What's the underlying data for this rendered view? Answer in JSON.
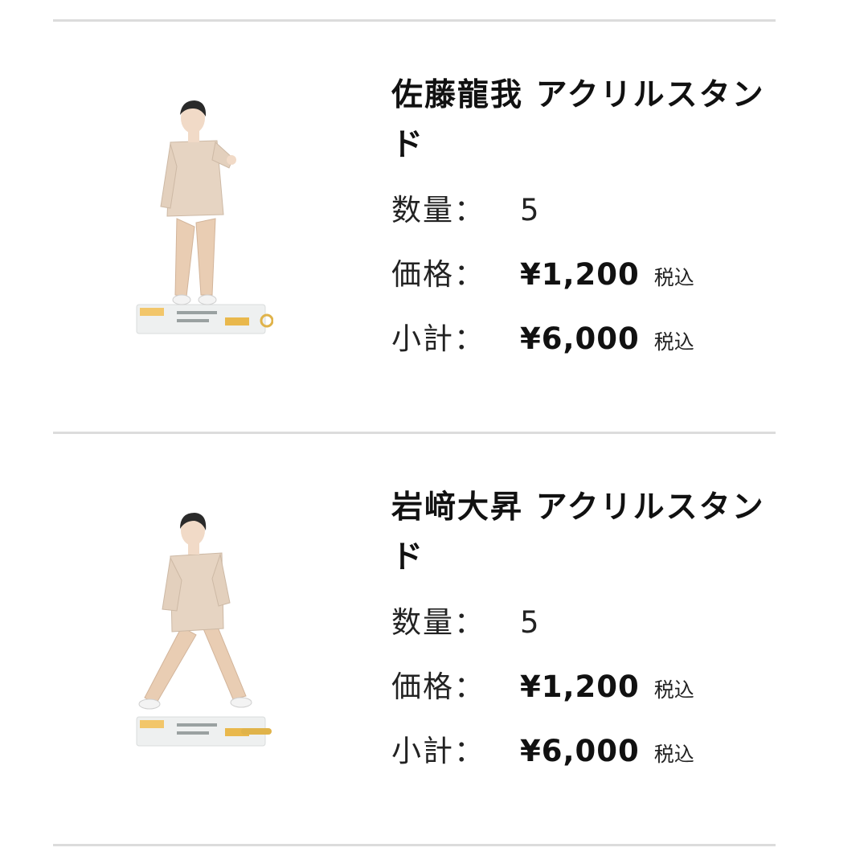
{
  "items": [
    {
      "title": "佐藤龍我 アクリルスタンド",
      "quantity_label": "数量：",
      "quantity": "5",
      "price_label": "価格：",
      "price": "¥1,200",
      "price_tax": "税込",
      "subtotal_label": "小計：",
      "subtotal": "¥6,000",
      "subtotal_tax": "税込",
      "image": "acrylic-stand-figure"
    },
    {
      "title": "岩﨑大昇 アクリルスタンド",
      "quantity_label": "数量：",
      "quantity": "5",
      "price_label": "価格：",
      "price": "¥1,200",
      "price_tax": "税込",
      "subtotal_label": "小計：",
      "subtotal": "¥6,000",
      "subtotal_tax": "税込",
      "image": "acrylic-stand-figure"
    }
  ],
  "colors": {
    "text": "#111111",
    "divider": "#dcdcdc",
    "background": "#ffffff"
  }
}
